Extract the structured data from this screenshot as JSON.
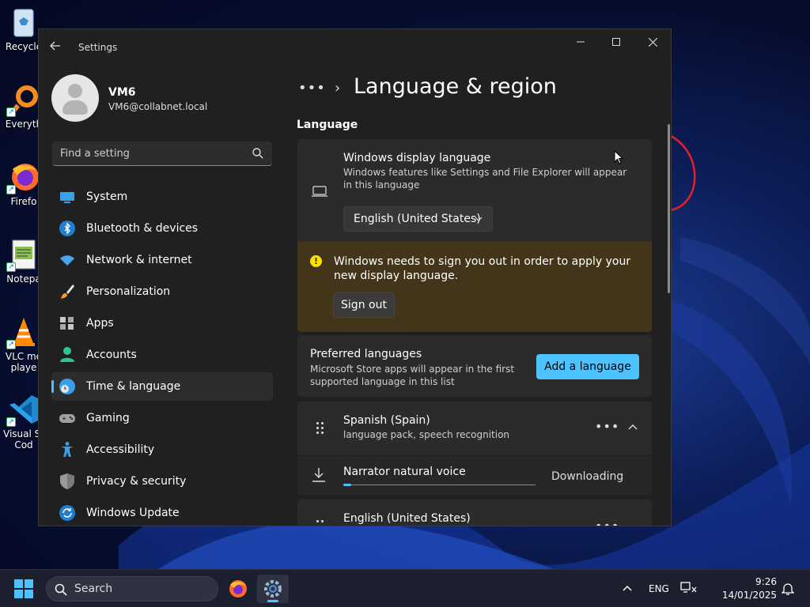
{
  "desktop": {
    "icons": [
      {
        "label": "Recycle",
        "icon": "recycle-bin-icon"
      },
      {
        "label": "Everyth",
        "icon": "everything-search-icon"
      },
      {
        "label": "Firefo",
        "icon": "firefox-icon"
      },
      {
        "label": "Notepa",
        "icon": "notepad-icon"
      },
      {
        "label": "VLC me",
        "label2": "playe",
        "icon": "vlc-icon"
      },
      {
        "label": "Visual St",
        "label2": "Cod",
        "icon": "vscode-icon"
      }
    ]
  },
  "window": {
    "title": "Settings",
    "controls": {
      "minimize": "minimize-icon",
      "maximize": "maximize-icon",
      "close": "close-icon"
    }
  },
  "user": {
    "name": "VM6",
    "email": "VM6@collabnet.local"
  },
  "search": {
    "placeholder": "Find a setting"
  },
  "nav": [
    {
      "label": "System",
      "icon": "system-icon"
    },
    {
      "label": "Bluetooth & devices",
      "icon": "bluetooth-icon"
    },
    {
      "label": "Network & internet",
      "icon": "wifi-icon"
    },
    {
      "label": "Personalization",
      "icon": "brush-icon"
    },
    {
      "label": "Apps",
      "icon": "apps-icon"
    },
    {
      "label": "Accounts",
      "icon": "account-icon"
    },
    {
      "label": "Time & language",
      "icon": "time-language-icon",
      "selected": true
    },
    {
      "label": "Gaming",
      "icon": "gamepad-icon"
    },
    {
      "label": "Accessibility",
      "icon": "accessibility-icon"
    },
    {
      "label": "Privacy & security",
      "icon": "shield-icon"
    },
    {
      "label": "Windows Update",
      "icon": "update-icon"
    }
  ],
  "main": {
    "breadcrumb_more": "•••",
    "page_title": "Language & region",
    "section_label": "Language",
    "display_language": {
      "title": "Windows display language",
      "description": "Windows features like Settings and File Explorer will appear in this language",
      "selected": "English (United States)"
    },
    "warning": {
      "text": "Windows needs to sign you out in order to apply your new display language.",
      "button": "Sign out"
    },
    "preferred": {
      "title": "Preferred languages",
      "description": "Microsoft Store apps will appear in the first supported language in this list",
      "button": "Add a language"
    },
    "languages": [
      {
        "name": "Spanish (Spain)",
        "detail": "language pack, speech recognition"
      },
      {
        "name": "English (United States)",
        "detail": ""
      }
    ],
    "download": {
      "label": "Narrator natural voice",
      "status": "Downloading",
      "progress": 0.04
    }
  },
  "taskbar": {
    "search_label": "Search",
    "language": "ENG",
    "time": "9:26",
    "date": "14/01/2025",
    "accent": "#4cc2ff"
  }
}
